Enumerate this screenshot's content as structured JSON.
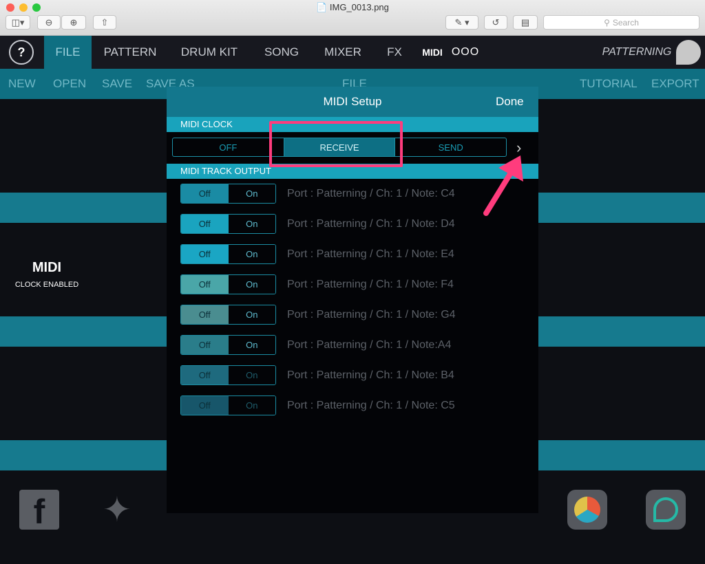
{
  "window": {
    "filename": "IMG_0013.png",
    "search_placeholder": "Search"
  },
  "topnav": {
    "help": "?",
    "items": [
      "FILE",
      "PATTERN",
      "DRUM KIT",
      "SONG",
      "MIXER",
      "FX"
    ],
    "midi_logo": "MIDI",
    "more": "OOO",
    "brand": "PATTERNING"
  },
  "subnav": {
    "left": [
      "NEW",
      "OPEN",
      "SAVE",
      "SAVE AS"
    ],
    "center": "FILE",
    "right": [
      "TUTORIAL",
      "EXPORT"
    ]
  },
  "side": {
    "midi_logo": "MIDI",
    "clock_status": "CLOCK ENABLED"
  },
  "modal": {
    "title": "MIDI Setup",
    "done": "Done",
    "clock_header": "MIDI CLOCK",
    "clock_options": [
      "OFF",
      "RECEIVE",
      "SEND"
    ],
    "clock_selected": "RECEIVE",
    "track_header": "MIDI TRACK OUTPUT",
    "tracks": [
      {
        "off": "Off",
        "on": "On",
        "port": "Port : Patterning / Ch: 1 / Note: C4",
        "color": "#1a8ba4"
      },
      {
        "off": "Off",
        "on": "On",
        "port": "Port : Patterning / Ch: 1 / Note: D4",
        "color": "#1aa4bf"
      },
      {
        "off": "Off",
        "on": "On",
        "port": "Port : Patterning / Ch: 1 / Note: E4",
        "color": "#1aa6c4"
      },
      {
        "off": "Off",
        "on": "On",
        "port": "Port : Patterning / Ch: 1 / Note: F4",
        "color": "#4aa6a8"
      },
      {
        "off": "Off",
        "on": "On",
        "port": "Port : Patterning / Ch: 1 / Note: G4",
        "color": "#4a8d90"
      },
      {
        "off": "Off",
        "on": "On",
        "port": "Port : Patterning / Ch: 1 / Note:A4",
        "color": "#2a7d8a"
      },
      {
        "off": "Off",
        "on": "On",
        "port": "Port : Patterning / Ch: 1 / Note: B4",
        "color": "#1e6a7e"
      },
      {
        "off": "Off",
        "on": "On",
        "port": "Port : Patterning / Ch: 1 / Note: C5",
        "color": "#17566a"
      }
    ]
  },
  "colors": {
    "accent": "#19a3bc",
    "highlight": "#ff3c7d"
  }
}
